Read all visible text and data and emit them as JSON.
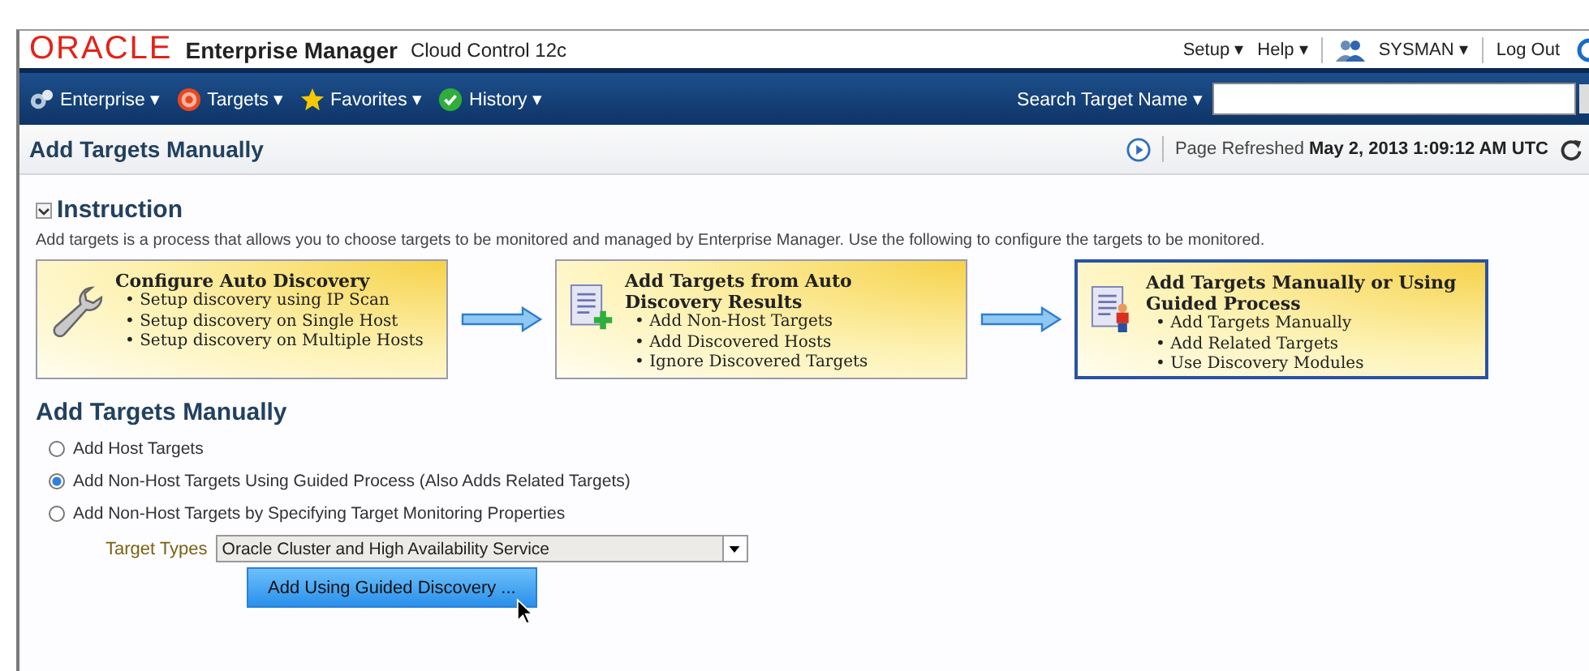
{
  "header": {
    "logo": "ORACLE",
    "product": "Enterprise Manager",
    "edition": "Cloud Control 12c",
    "links": [
      {
        "label": "Setup",
        "caret": "▾"
      },
      {
        "label": "Help",
        "caret": "▾"
      }
    ],
    "user": {
      "name": "SYSMAN",
      "caret": "▾"
    },
    "logout": "Log Out"
  },
  "nav": {
    "menus": [
      {
        "label": "Enterprise",
        "caret": "▾"
      },
      {
        "label": "Targets",
        "caret": "▾"
      },
      {
        "label": "Favorites",
        "caret": "▾"
      },
      {
        "label": "History",
        "caret": "▾"
      }
    ],
    "search": {
      "label": "Search Target Name",
      "caret": "▾"
    }
  },
  "title_bar": {
    "title": "Add Targets Manually",
    "refreshed_label": "Page Refreshed",
    "refreshed_time": "May 2, 2013 1:09:12 AM UTC"
  },
  "instruction": {
    "heading": "Instruction",
    "expanded": true,
    "text": "Add targets is a process that allows you to choose targets to be monitored and managed by Enterprise Manager. Use the following to configure the targets to be monitored.",
    "steps": [
      {
        "title": "Configure Auto Discovery",
        "selected": false,
        "bullets": [
          "• Setup discovery using IP Scan",
          "• Setup discovery on Single Host",
          "• Setup discovery on Multiple Hosts"
        ]
      },
      {
        "title": "Add Targets from Auto Discovery Results",
        "selected": false,
        "bullets": [
          "• Add Non-Host Targets",
          "• Add Discovered Hosts",
          "• Ignore Discovered Targets"
        ]
      },
      {
        "title": "Add Targets Manually or Using Guided Process",
        "selected": true,
        "bullets": [
          "• Add Targets Manually",
          "• Add Related Targets",
          "• Use Discovery Modules"
        ]
      }
    ]
  },
  "manual": {
    "heading": "Add Targets Manually",
    "options": [
      {
        "label": "Add Host Targets",
        "selected": false
      },
      {
        "label": "Add Non-Host Targets Using Guided Process (Also Adds Related Targets)",
        "selected": true
      },
      {
        "label": "Add Non-Host Targets by Specifying Target Monitoring Properties",
        "selected": false
      }
    ],
    "target_types": {
      "label": "Target Types",
      "value": "Oracle Cluster and High Availability Service"
    },
    "button": "Add Using Guided Discovery ..."
  }
}
